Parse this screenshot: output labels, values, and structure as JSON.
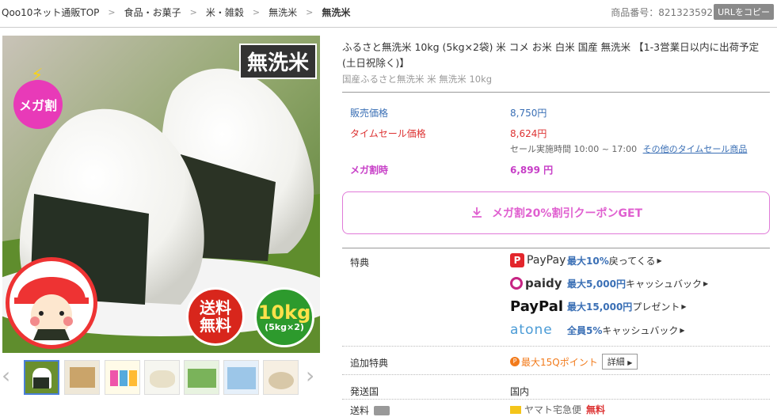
{
  "breadcrumb": {
    "items": [
      "Qoo10ネット通販TOP",
      "食品・お菓子",
      "米・雑穀",
      "無洗米"
    ],
    "current": "無洗米",
    "separator": ">"
  },
  "product_number": "商品番号：821323592",
  "copy_url_label": "URLをコピー",
  "image": {
    "badge_musenmai": "無洗米",
    "badge_mega": "メガ割",
    "badge_free_shipping": "送料無料",
    "badge_weight_main": "10kg",
    "badge_weight_sub": "(5kg×2)"
  },
  "product": {
    "title": "ふるさと無洗米 10kg (5kg×2袋) 米 コメ お米 白米 国産 無洗米 【1-3営業日以内に出荷予定(土日祝除く)】",
    "subtitle": "国産ふるさと無洗米 米 無洗米 10kg"
  },
  "price": {
    "regular_label": "販売価格",
    "regular_value": "8,750円",
    "timesale_label": "タイムセール価格",
    "timesale_value": "8,624円",
    "timesale_period": "セール実施時間 10:00 ~ 17:00",
    "timesale_link": "その他のタイムセール商品",
    "mega_label": "メガ割時",
    "mega_value": "6,899 円"
  },
  "coupon_button": "メガ割20%割引クーポンGET",
  "benefits": {
    "label": "特典",
    "items": [
      {
        "logo": "PayPay",
        "highlight": "最大10%",
        "text": "戻ってくる"
      },
      {
        "logo": "paidy",
        "highlight": "最大5,000円",
        "text": "キャッシュバック"
      },
      {
        "logo": "PayPal",
        "highlight": "最大15,000円",
        "text": "プレゼント"
      },
      {
        "logo": "atone",
        "highlight": "全員5%",
        "text": "キャッシュバック"
      }
    ]
  },
  "extra": {
    "label": "追加特典",
    "points": "最大15Qポイント",
    "detail_button": "詳細"
  },
  "ship_country": {
    "label": "発送国",
    "value": "国内"
  },
  "shipping": {
    "label": "送料",
    "carrier": "ヤマト宅急便",
    "value": "無料"
  },
  "colors": {
    "accent_pink": "#e060d0",
    "price_red": "#dd3333",
    "link_blue": "#3a6fb5"
  }
}
